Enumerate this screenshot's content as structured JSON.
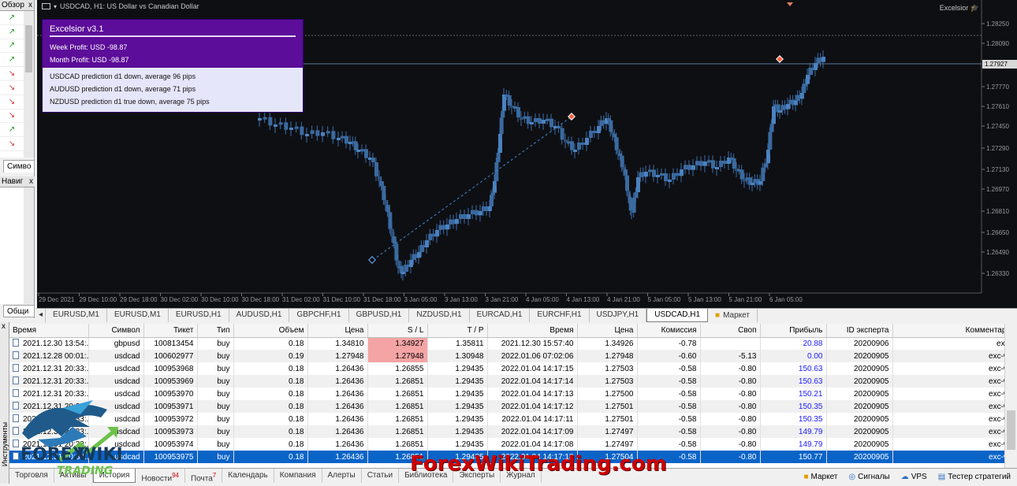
{
  "market_watch": {
    "title": "Обзор",
    "close": "x",
    "tab": "Симво",
    "rows": [
      "up",
      "up",
      "up",
      "up",
      "down",
      "down",
      "down",
      "down",
      "up",
      "down"
    ]
  },
  "navigator": {
    "title": "Навиг",
    "close": "x",
    "tab": "Общи"
  },
  "chart": {
    "title": "USDCAD, H1:  US Dollar vs Canadian Dollar",
    "ea_label": "Excelsior",
    "price_labels": [
      "1.28250",
      "1.28090",
      "1.27770",
      "1.27610",
      "1.27450",
      "1.27290",
      "1.27130",
      "1.26970",
      "1.26810",
      "1.26650",
      "1.26490",
      "1.26330"
    ],
    "current_price": "1.27927",
    "time_labels": [
      "29 Dec 2021",
      "29 Dec 10:00",
      "29 Dec 18:00",
      "30 Dec 02:00",
      "30 Dec 10:00",
      "30 Dec 18:00",
      "31 Dec 02:00",
      "31 Dec 10:00",
      "31 Dec 18:00",
      "3 Jan 05:00",
      "3 Jan 13:00",
      "3 Jan 21:00",
      "4 Jan 05:00",
      "4 Jan 13:00",
      "4 Jan 21:00",
      "5 Jan 05:00",
      "5 Jan 13:00",
      "5 Jan 21:00",
      "6 Jan 05:00"
    ],
    "colors": {
      "background": "#0e0f13",
      "bull": "#3d6ea8",
      "bear": "#3d6ea8",
      "grid_text": "#9a9a9a"
    }
  },
  "overlay": {
    "title": "Excelsior v3.1",
    "week_profit": "Week Profit: USD -98.87",
    "month_profit": "Month Profit: USD -98.87",
    "predictions": [
      "USDCAD prediction d1 down, average 96 pips",
      "AUDUSD prediction d1 down, average 71 pips",
      "NZDUSD prediction d1 true down, average 75 pips"
    ]
  },
  "chart_tabs": [
    "EURUSD,M1",
    "EURUSD,M1",
    "EURUSD,H1",
    "AUDUSD,H1",
    "GBPCHF,H1",
    "GBPUSD,H1",
    "NZDUSD,H1",
    "EURCAD,H1",
    "EURCHF,H1",
    "USDJPY,H1",
    "USDCAD,H1"
  ],
  "chart_tab_active": 10,
  "market_tab": "Маркет",
  "terminal": {
    "side_label": "Инструменты",
    "close": "x",
    "columns": [
      "Время",
      "Символ",
      "Тикет",
      "Тип",
      "Объем",
      "Цена",
      "S / L",
      "T / P",
      "Время",
      "Цена",
      "Комиссия",
      "Своп",
      "Прибыль",
      "ID эксперта",
      "Комментарий"
    ],
    "sort_marker": "▲",
    "rows": [
      [
        "2021.12.30 13:54:...",
        "gbpusd",
        "100813454",
        "buy",
        "0.18",
        "1.34810",
        "1.34927",
        "1.35811",
        "2021.12.30 15:57:40",
        "1.34926",
        "-0.78",
        "",
        "20.88",
        "20200906",
        "exc-daily"
      ],
      [
        "2021.12.28 00:01:...",
        "usdcad",
        "100602977",
        "buy",
        "0.19",
        "1.27948",
        "1.27948",
        "1.30948",
        "2022.01.06 07:02:06",
        "1.27948",
        "-0.60",
        "-5.13",
        "0.00",
        "20200905",
        "exc-weekly"
      ],
      [
        "2021.12.31 20:33:...",
        "usdcad",
        "100953968",
        "buy",
        "0.18",
        "1.26436",
        "1.26855",
        "1.29435",
        "2022.01.04 14:17:15",
        "1.27503",
        "-0.58",
        "-0.80",
        "150.63",
        "20200905",
        "exc-weekly"
      ],
      [
        "2021.12.31 20:33:...",
        "usdcad",
        "100953969",
        "buy",
        "0.18",
        "1.26436",
        "1.26851",
        "1.29435",
        "2022.01.04 14:17:14",
        "1.27503",
        "-0.58",
        "-0.80",
        "150.63",
        "20200905",
        "exc-weekly"
      ],
      [
        "2021.12.31 20:33:...",
        "usdcad",
        "100953970",
        "buy",
        "0.18",
        "1.26436",
        "1.26851",
        "1.29435",
        "2022.01.04 14:17:13",
        "1.27500",
        "-0.58",
        "-0.80",
        "150.21",
        "20200905",
        "exc-weekly"
      ],
      [
        "2021.12.31 20:33:...",
        "usdcad",
        "100953971",
        "buy",
        "0.18",
        "1.26436",
        "1.26851",
        "1.29435",
        "2022.01.04 14:17:12",
        "1.27501",
        "-0.58",
        "-0.80",
        "150.35",
        "20200905",
        "exc-weekly"
      ],
      [
        "2021.12.31 20:33:...",
        "usdcad",
        "100953972",
        "buy",
        "0.18",
        "1.26436",
        "1.26851",
        "1.29435",
        "2022.01.04 14:17:11",
        "1.27501",
        "-0.58",
        "-0.80",
        "150.35",
        "20200905",
        "exc-weekly"
      ],
      [
        "2021.12.31 20:33:...",
        "usdcad",
        "100953973",
        "buy",
        "0.18",
        "1.26436",
        "1.26851",
        "1.29435",
        "2022.01.04 14:17:09",
        "1.27497",
        "-0.58",
        "-0.80",
        "149.79",
        "20200905",
        "exc-weekly"
      ],
      [
        "2021.12.31 20:33:...",
        "usdcad",
        "100953974",
        "buy",
        "0.18",
        "1.26436",
        "1.26851",
        "1.29435",
        "2022.01.04 14:17:08",
        "1.27497",
        "-0.58",
        "-0.80",
        "149.79",
        "20200905",
        "exc-weekly"
      ],
      [
        "2021.12.31 20:33:...",
        "usdcad",
        "100953975",
        "buy",
        "0.18",
        "1.26436",
        "1.26851",
        "1.29435",
        "2022.01.04 14:17:18",
        "1.27504",
        "-0.58",
        "-0.80",
        "150.77",
        "20200905",
        "exc-weekly"
      ]
    ],
    "selected_row": 9,
    "highlight_sl_rows": [
      0,
      1
    ]
  },
  "bottom_tabs": [
    {
      "label": "Торговля"
    },
    {
      "label": "Активы"
    },
    {
      "label": "История",
      "active": true
    },
    {
      "label": "Новости",
      "badge": "94"
    },
    {
      "label": "Почта",
      "badge": "7"
    },
    {
      "label": "Календарь"
    },
    {
      "label": "Компания"
    },
    {
      "label": "Алерты"
    },
    {
      "label": "Статьи"
    },
    {
      "label": "Библиотека"
    },
    {
      "label": "Эксперты"
    },
    {
      "label": "Журнал"
    }
  ],
  "bottom_right": [
    "Маркет",
    "Сигналы",
    "VPS",
    "Тестер стратегий"
  ],
  "watermark": {
    "logo": "FOREX WIKI TRADING",
    "text": "ForexWikiTrading.com"
  }
}
